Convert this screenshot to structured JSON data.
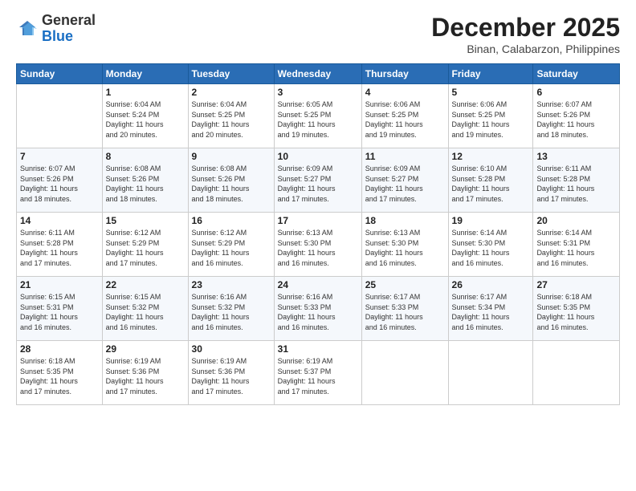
{
  "header": {
    "logo_general": "General",
    "logo_blue": "Blue",
    "month": "December 2025",
    "location": "Binan, Calabarzon, Philippines"
  },
  "weekdays": [
    "Sunday",
    "Monday",
    "Tuesday",
    "Wednesday",
    "Thursday",
    "Friday",
    "Saturday"
  ],
  "weeks": [
    [
      {
        "day": "",
        "info": ""
      },
      {
        "day": "1",
        "info": "Sunrise: 6:04 AM\nSunset: 5:24 PM\nDaylight: 11 hours\nand 20 minutes."
      },
      {
        "day": "2",
        "info": "Sunrise: 6:04 AM\nSunset: 5:25 PM\nDaylight: 11 hours\nand 20 minutes."
      },
      {
        "day": "3",
        "info": "Sunrise: 6:05 AM\nSunset: 5:25 PM\nDaylight: 11 hours\nand 19 minutes."
      },
      {
        "day": "4",
        "info": "Sunrise: 6:06 AM\nSunset: 5:25 PM\nDaylight: 11 hours\nand 19 minutes."
      },
      {
        "day": "5",
        "info": "Sunrise: 6:06 AM\nSunset: 5:25 PM\nDaylight: 11 hours\nand 19 minutes."
      },
      {
        "day": "6",
        "info": "Sunrise: 6:07 AM\nSunset: 5:26 PM\nDaylight: 11 hours\nand 18 minutes."
      }
    ],
    [
      {
        "day": "7",
        "info": "Sunrise: 6:07 AM\nSunset: 5:26 PM\nDaylight: 11 hours\nand 18 minutes."
      },
      {
        "day": "8",
        "info": "Sunrise: 6:08 AM\nSunset: 5:26 PM\nDaylight: 11 hours\nand 18 minutes."
      },
      {
        "day": "9",
        "info": "Sunrise: 6:08 AM\nSunset: 5:26 PM\nDaylight: 11 hours\nand 18 minutes."
      },
      {
        "day": "10",
        "info": "Sunrise: 6:09 AM\nSunset: 5:27 PM\nDaylight: 11 hours\nand 17 minutes."
      },
      {
        "day": "11",
        "info": "Sunrise: 6:09 AM\nSunset: 5:27 PM\nDaylight: 11 hours\nand 17 minutes."
      },
      {
        "day": "12",
        "info": "Sunrise: 6:10 AM\nSunset: 5:28 PM\nDaylight: 11 hours\nand 17 minutes."
      },
      {
        "day": "13",
        "info": "Sunrise: 6:11 AM\nSunset: 5:28 PM\nDaylight: 11 hours\nand 17 minutes."
      }
    ],
    [
      {
        "day": "14",
        "info": "Sunrise: 6:11 AM\nSunset: 5:28 PM\nDaylight: 11 hours\nand 17 minutes."
      },
      {
        "day": "15",
        "info": "Sunrise: 6:12 AM\nSunset: 5:29 PM\nDaylight: 11 hours\nand 17 minutes."
      },
      {
        "day": "16",
        "info": "Sunrise: 6:12 AM\nSunset: 5:29 PM\nDaylight: 11 hours\nand 16 minutes."
      },
      {
        "day": "17",
        "info": "Sunrise: 6:13 AM\nSunset: 5:30 PM\nDaylight: 11 hours\nand 16 minutes."
      },
      {
        "day": "18",
        "info": "Sunrise: 6:13 AM\nSunset: 5:30 PM\nDaylight: 11 hours\nand 16 minutes."
      },
      {
        "day": "19",
        "info": "Sunrise: 6:14 AM\nSunset: 5:30 PM\nDaylight: 11 hours\nand 16 minutes."
      },
      {
        "day": "20",
        "info": "Sunrise: 6:14 AM\nSunset: 5:31 PM\nDaylight: 11 hours\nand 16 minutes."
      }
    ],
    [
      {
        "day": "21",
        "info": "Sunrise: 6:15 AM\nSunset: 5:31 PM\nDaylight: 11 hours\nand 16 minutes."
      },
      {
        "day": "22",
        "info": "Sunrise: 6:15 AM\nSunset: 5:32 PM\nDaylight: 11 hours\nand 16 minutes."
      },
      {
        "day": "23",
        "info": "Sunrise: 6:16 AM\nSunset: 5:32 PM\nDaylight: 11 hours\nand 16 minutes."
      },
      {
        "day": "24",
        "info": "Sunrise: 6:16 AM\nSunset: 5:33 PM\nDaylight: 11 hours\nand 16 minutes."
      },
      {
        "day": "25",
        "info": "Sunrise: 6:17 AM\nSunset: 5:33 PM\nDaylight: 11 hours\nand 16 minutes."
      },
      {
        "day": "26",
        "info": "Sunrise: 6:17 AM\nSunset: 5:34 PM\nDaylight: 11 hours\nand 16 minutes."
      },
      {
        "day": "27",
        "info": "Sunrise: 6:18 AM\nSunset: 5:35 PM\nDaylight: 11 hours\nand 16 minutes."
      }
    ],
    [
      {
        "day": "28",
        "info": "Sunrise: 6:18 AM\nSunset: 5:35 PM\nDaylight: 11 hours\nand 17 minutes."
      },
      {
        "day": "29",
        "info": "Sunrise: 6:19 AM\nSunset: 5:36 PM\nDaylight: 11 hours\nand 17 minutes."
      },
      {
        "day": "30",
        "info": "Sunrise: 6:19 AM\nSunset: 5:36 PM\nDaylight: 11 hours\nand 17 minutes."
      },
      {
        "day": "31",
        "info": "Sunrise: 6:19 AM\nSunset: 5:37 PM\nDaylight: 11 hours\nand 17 minutes."
      },
      {
        "day": "",
        "info": ""
      },
      {
        "day": "",
        "info": ""
      },
      {
        "day": "",
        "info": ""
      }
    ]
  ]
}
